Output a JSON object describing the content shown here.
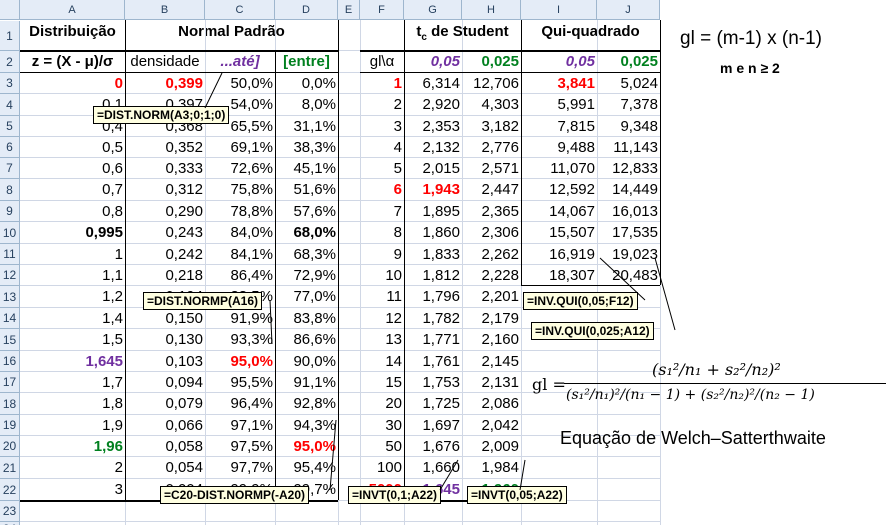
{
  "columns": [
    "A",
    "B",
    "C",
    "D",
    "E",
    "F",
    "G",
    "H",
    "I",
    "J"
  ],
  "rows": [
    "1",
    "2",
    "3",
    "4",
    "5",
    "6",
    "7",
    "8",
    "9",
    "10",
    "11",
    "12",
    "13",
    "14",
    "15",
    "16",
    "17",
    "18",
    "19",
    "20",
    "21",
    "22",
    "23",
    "24"
  ],
  "headers": {
    "distribuicao": "Distribuição",
    "normal_padrao": "Normal Padrão",
    "t_student_pre": "t",
    "t_student_sub": "c",
    "t_student_post": " de Student",
    "qui_quadrado": "Qui-quadrado",
    "z_formula": "z = (X - μ)/σ",
    "densidade": "densidade",
    "ate": "...até]",
    "entre": "[entre]",
    "gl_alpha": "gl\\α",
    "a1": "0,05",
    "a2": "0,025",
    "a3": "0,05",
    "a4": "0,025"
  },
  "normal_rows": [
    [
      "0",
      "0,399",
      "50,0%",
      "0,0%"
    ],
    [
      "0,1",
      "0,397",
      "54,0%",
      "8,0%"
    ],
    [
      "0,4",
      "0,368",
      "65,5%",
      "31,1%"
    ],
    [
      "0,5",
      "0,352",
      "69,1%",
      "38,3%"
    ],
    [
      "0,6",
      "0,333",
      "72,6%",
      "45,1%"
    ],
    [
      "0,7",
      "0,312",
      "75,8%",
      "51,6%"
    ],
    [
      "0,8",
      "0,290",
      "78,8%",
      "57,6%"
    ],
    [
      "0,995",
      "0,243",
      "84,0%",
      "68,0%"
    ],
    [
      "1",
      "0,242",
      "84,1%",
      "68,3%"
    ],
    [
      "1,1",
      "0,218",
      "86,4%",
      "72,9%"
    ],
    [
      "1,2",
      "0,194",
      "88,5%",
      "77,0%"
    ],
    [
      "1,4",
      "0,150",
      "91,9%",
      "83,8%"
    ],
    [
      "1,5",
      "0,130",
      "93,3%",
      "86,6%"
    ],
    [
      "1,645",
      "0,103",
      "95,0%",
      "90,0%"
    ],
    [
      "1,7",
      "0,094",
      "95,5%",
      "91,1%"
    ],
    [
      "1,8",
      "0,079",
      "96,4%",
      "92,8%"
    ],
    [
      "1,9",
      "0,066",
      "97,1%",
      "94,3%"
    ],
    [
      "1,96",
      "0,058",
      "97,5%",
      "95,0%"
    ],
    [
      "2",
      "0,054",
      "97,7%",
      "95,4%"
    ],
    [
      "3",
      "0,004",
      "99,9%",
      "99,7%"
    ]
  ],
  "student_rows": [
    [
      "1",
      "6,314",
      "12,706",
      "3,841",
      "5,024"
    ],
    [
      "2",
      "2,920",
      "4,303",
      "5,991",
      "7,378"
    ],
    [
      "3",
      "2,353",
      "3,182",
      "7,815",
      "9,348"
    ],
    [
      "4",
      "2,132",
      "2,776",
      "9,488",
      "11,143"
    ],
    [
      "5",
      "2,015",
      "2,571",
      "11,070",
      "12,833"
    ],
    [
      "6",
      "1,943",
      "2,447",
      "12,592",
      "14,449"
    ],
    [
      "7",
      "1,895",
      "2,365",
      "14,067",
      "16,013"
    ],
    [
      "8",
      "1,860",
      "2,306",
      "15,507",
      "17,535"
    ],
    [
      "9",
      "1,833",
      "2,262",
      "16,919",
      "19,023"
    ],
    [
      "10",
      "1,812",
      "2,228",
      "18,307",
      "20,483"
    ],
    [
      "11",
      "1,796",
      "2,201",
      "",
      ""
    ],
    [
      "12",
      "1,782",
      "2,179",
      "",
      ""
    ],
    [
      "13",
      "1,771",
      "2,160",
      "",
      ""
    ],
    [
      "14",
      "1,761",
      "2,145",
      "",
      ""
    ],
    [
      "15",
      "1,753",
      "2,131",
      "",
      ""
    ],
    [
      "20",
      "1,725",
      "2,086",
      "",
      ""
    ],
    [
      "30",
      "1,697",
      "2,042",
      "",
      ""
    ],
    [
      "50",
      "1,676",
      "2,009",
      "",
      ""
    ],
    [
      "100",
      "1,660",
      "1,984",
      "",
      ""
    ],
    [
      "5000",
      "1,645",
      "1,960",
      "",
      ""
    ]
  ],
  "tooltips": {
    "dist_norm": "=DIST.NORM(A3;0;1;0)",
    "dist_normp": "=DIST.NORMP(A16)",
    "c20": "=C20-DIST.NORMP(-A20)",
    "invt1": "=INVT(0,1;A22)",
    "invt2": "=INVT(0,05;A22)",
    "invqui1": "=INV.QUI(0,05;F12)",
    "invqui2": "=INV.QUI(0,025;A12)"
  },
  "notes": {
    "gl_formula": "gl = (m-1) x (n-1)",
    "m_e_n": "m e n ≥ 2",
    "welch_label": "gl =",
    "welch_num": "(s₁²/n₁ + s₂²/n₂)²",
    "welch_den": "(s₁²/n₁)²/(n₁ − 1) + (s₂²/n₂)²/(n₂ − 1)",
    "welch_title": "Equação de Welch–Satterthwaite"
  }
}
